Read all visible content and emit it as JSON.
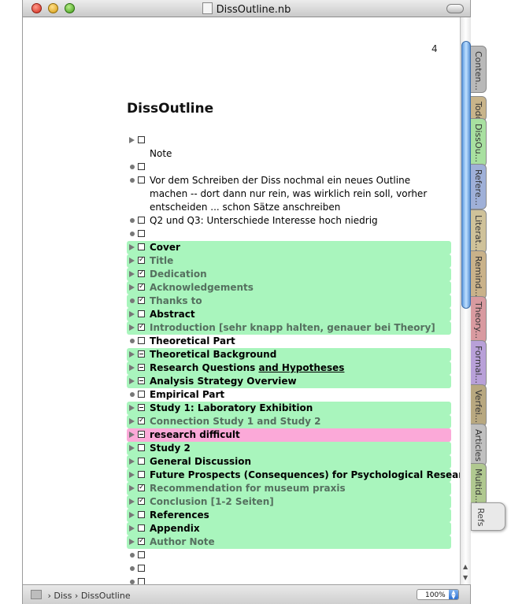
{
  "window": {
    "title": "DissOutline.nb"
  },
  "page": {
    "number": "4"
  },
  "document": {
    "title": "DissOutline"
  },
  "outline": [
    {
      "text": "",
      "bullet": "triangle",
      "check": "empty",
      "style": "plain"
    },
    {
      "text": "Note",
      "bullet": "none",
      "check": "none",
      "style": "plain"
    },
    {
      "text": "",
      "bullet": "dot",
      "check": "empty",
      "style": "plain"
    },
    {
      "text": "Vor dem Schreiben der Diss nochmal ein neues Outline machen -- dort dann nur rein, was wirklich rein soll, vorher entscheiden ... schon Sätze anschreiben",
      "bullet": "dot",
      "check": "empty",
      "style": "plain"
    },
    {
      "text": "Q2 und Q3: Unterschiede Interesse hoch niedrig",
      "bullet": "dot",
      "check": "empty",
      "style": "plain"
    },
    {
      "text": "",
      "bullet": "dot",
      "check": "empty",
      "style": "plain"
    },
    {
      "text": "Cover",
      "bullet": "triangle",
      "check": "empty",
      "style": "green-bold"
    },
    {
      "text": "Title",
      "bullet": "triangle",
      "check": "checked",
      "style": "green-dim"
    },
    {
      "text": "Dedication",
      "bullet": "triangle",
      "check": "checked",
      "style": "green-dim"
    },
    {
      "text": "Acknowledgements",
      "bullet": "triangle",
      "check": "checked",
      "style": "green-dim"
    },
    {
      "text": "Thanks to",
      "bullet": "dot",
      "check": "checked",
      "style": "green-dim"
    },
    {
      "text": "Abstract",
      "bullet": "triangle",
      "check": "empty",
      "style": "green-bold"
    },
    {
      "text": "Introduction [sehr knapp halten, genauer bei Theory]",
      "bullet": "triangle",
      "check": "checked",
      "style": "green-dim"
    },
    {
      "text": "Theoretical Part",
      "bullet": "dot",
      "check": "empty",
      "style": "bold"
    },
    {
      "text": "Theoretical Background",
      "bullet": "triangle",
      "check": "minus",
      "style": "green-bold"
    },
    {
      "text": "Research Questions ",
      "underline": "and Hypotheses",
      "bullet": "triangle",
      "check": "minus",
      "style": "green-bold"
    },
    {
      "text": "Analysis Strategy Overview",
      "bullet": "triangle",
      "check": "minus",
      "style": "green-bold"
    },
    {
      "text": "Empirical Part",
      "bullet": "dot",
      "check": "empty",
      "style": "bold"
    },
    {
      "text": "Study 1: Laboratory Exhibition",
      "bullet": "triangle",
      "check": "minus",
      "style": "green-bold"
    },
    {
      "text": "Connection Study 1 and Study 2",
      "bullet": "triangle",
      "check": "checked",
      "style": "green-dim"
    },
    {
      "text": "research difficult",
      "bullet": "triangle",
      "check": "minus",
      "style": "pink-bold"
    },
    {
      "text": "Study 2",
      "bullet": "triangle",
      "check": "empty",
      "style": "green-bold"
    },
    {
      "text": "General Discussion",
      "bullet": "triangle",
      "check": "empty",
      "style": "green-bold"
    },
    {
      "text": "Future Prospects (Consequences) for Psychological Research",
      "bullet": "triangle",
      "check": "empty",
      "style": "green-bold"
    },
    {
      "text": "Recommendation for museum praxis",
      "bullet": "triangle",
      "check": "checked",
      "style": "green-dim"
    },
    {
      "text": "Conclusion [1-2 Seiten]",
      "bullet": "triangle",
      "check": "checked",
      "style": "green-dim"
    },
    {
      "text": "References",
      "bullet": "triangle",
      "check": "empty",
      "style": "green-bold"
    },
    {
      "text": "Appendix",
      "bullet": "triangle",
      "check": "empty",
      "style": "green-bold"
    },
    {
      "text": "Author Note",
      "bullet": "triangle",
      "check": "checked",
      "style": "green-dim"
    },
    {
      "text": "",
      "bullet": "dot",
      "check": "empty",
      "style": "plain"
    },
    {
      "text": "",
      "bullet": "dot",
      "check": "empty",
      "style": "plain"
    },
    {
      "text": "",
      "bullet": "dot",
      "check": "empty",
      "style": "plain"
    }
  ],
  "statusbar": {
    "crumb1": "Diss",
    "crumb2": "DissOutline",
    "separator": "›",
    "zoom": "100%"
  },
  "tabs": [
    {
      "label": "Conten...",
      "color": "#b9b9b9"
    },
    {
      "label": "Todo",
      "color": "#c8b48a"
    },
    {
      "label": "DissOu...",
      "color": "#a8e0a0"
    },
    {
      "label": "Refere...",
      "color": "#9fb0d8"
    },
    {
      "label": "Literat...",
      "color": "#cfc29a"
    },
    {
      "label": "Remind...",
      "color": "#c9b28a"
    },
    {
      "label": "Theory...",
      "color": "#d89aa0"
    },
    {
      "label": "Formal...",
      "color": "#b8a0d8"
    },
    {
      "label": "Verfei...",
      "color": "#b8a880"
    },
    {
      "label": "Articles",
      "color": "#c0c0c0"
    },
    {
      "label": "Multid...",
      "color": "#b0c890"
    },
    {
      "label": "Refs",
      "color": "#e9e9e9"
    }
  ]
}
